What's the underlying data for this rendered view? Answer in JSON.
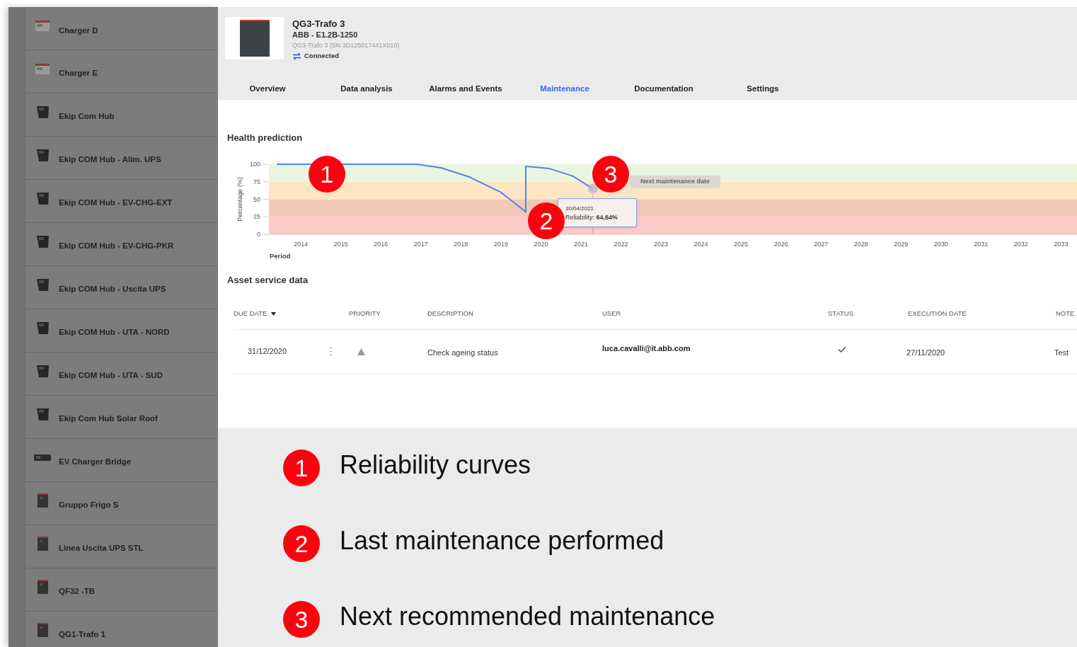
{
  "sidebar": {
    "items": [
      {
        "label": "Charger D",
        "kind": "meter"
      },
      {
        "label": "Charger E",
        "kind": "meter"
      },
      {
        "label": "Ekip Com Hub",
        "kind": "hub"
      },
      {
        "label": "Ekip COM Hub - Alim. UPS",
        "kind": "hub"
      },
      {
        "label": "Ekip COM Hub - EV-CHG-EXT",
        "kind": "hub"
      },
      {
        "label": "Ekip COM Hub - EV-CHG-PKR",
        "kind": "hub"
      },
      {
        "label": "Ekip COM Hub - Uscita UPS",
        "kind": "hub"
      },
      {
        "label": "Ekip COM Hub - UTA - NORD",
        "kind": "hub"
      },
      {
        "label": "Ekip COM Hub - UTA - SUD",
        "kind": "hub"
      },
      {
        "label": "Ekip Com Hub Solar Roof",
        "kind": "hub"
      },
      {
        "label": "EV Charger Bridge",
        "kind": "strip"
      },
      {
        "label": "Gruppo Frigo S",
        "kind": "breaker"
      },
      {
        "label": "Linea Uscita UPS STL",
        "kind": "breaker"
      },
      {
        "label": "QF32 -TB",
        "kind": "breaker"
      },
      {
        "label": "QG1-Trafo 1",
        "kind": "breaker"
      }
    ]
  },
  "device": {
    "title": "QG3-Trafo 3",
    "model": "ABB - E1.2B-1250",
    "serial": "QG3-Trafo 3 (SN 3D125017441X010)",
    "connection": "Connected"
  },
  "tabs": [
    {
      "label": "Overview",
      "selected": false
    },
    {
      "label": "Data analysis",
      "selected": false
    },
    {
      "label": "Alarms and Events",
      "selected": false
    },
    {
      "label": "Maintenance",
      "selected": true
    },
    {
      "label": "Documentation",
      "selected": false
    },
    {
      "label": "Settings",
      "selected": false
    }
  ],
  "health_prediction": {
    "title": "Health prediction",
    "chart_data": {
      "type": "line",
      "xlabel": "Period",
      "ylabel": "Percentage (%)",
      "xlim": [
        2013.2,
        2033.4
      ],
      "ylim": [
        0,
        100
      ],
      "bands": [
        {
          "axis": "y",
          "from": 0,
          "to": 25,
          "color": "#fdc9c9"
        },
        {
          "axis": "y",
          "from": 25,
          "to": 50,
          "color": "#f1c8b6"
        },
        {
          "axis": "y",
          "from": 50,
          "to": 75,
          "color": "#fde5c4"
        },
        {
          "axis": "y",
          "from": 75,
          "to": 100,
          "color": "#e9f5de"
        }
      ],
      "xticks": [
        2014,
        2015,
        2016,
        2017,
        2018,
        2019,
        2020,
        2021,
        2022,
        2023,
        2024,
        2025,
        2026,
        2027,
        2028,
        2029,
        2030,
        2031,
        2032,
        2033
      ],
      "yticks": [
        0,
        25,
        50,
        75,
        100
      ],
      "x": [
        2013.4,
        2016.9,
        2017.5,
        2018.2,
        2019,
        2019.62,
        2019.62,
        2020.2,
        2020.8,
        2021.3
      ],
      "series": [
        {
          "color": "#4d84f5",
          "values": [
            100,
            100,
            95,
            82,
            60,
            32,
            97,
            94,
            83,
            65
          ]
        }
      ]
    },
    "tooltip": {
      "date": "30/04/2021",
      "text": "Reliability: **64,64%**"
    },
    "next_label": "Next maintenance date",
    "callouts": [
      "1",
      "2",
      "3"
    ]
  },
  "service": {
    "title": "Asset service data",
    "columns": [
      {
        "label": "DUE DATE",
        "sorted": true
      },
      {
        "label": "PRIORITY",
        "sorted": false
      },
      {
        "label": "DESCRIPTION",
        "sorted": false
      },
      {
        "label": "USER",
        "sorted": false
      },
      {
        "label": "STATUS",
        "sorted": false
      },
      {
        "label": "EXECUTION DATE",
        "sorted": false
      },
      {
        "label": "NOTE",
        "sorted": false
      }
    ],
    "rows": [
      {
        "due_date": "31/12/2020",
        "description": "Check ageing status",
        "user": "luca.cavalli@it.abb.com",
        "done": true,
        "execution_date": "27/11/2020",
        "notes": "Test"
      }
    ]
  },
  "legend": [
    {
      "number": "1",
      "text": "Reliability curves"
    },
    {
      "number": "2",
      "text": "Last maintenance performed"
    },
    {
      "number": "3",
      "text": "Next recommended maintenance"
    }
  ]
}
